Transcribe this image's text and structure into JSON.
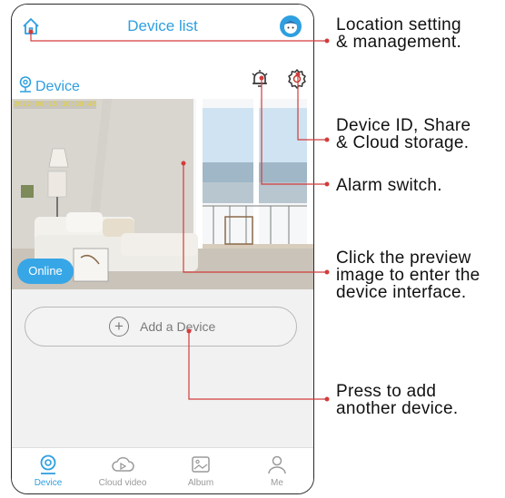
{
  "header": {
    "title": "Device list",
    "home_icon": "home-icon",
    "avatar_icon": "avatar-icon"
  },
  "device": {
    "label": "Device",
    "timestamp": "2022-06-15  10:39:48",
    "status": "Online",
    "alarm_icon": "bell-alarm-icon",
    "settings_icon": "gear-icon"
  },
  "add_device": {
    "label": "Add a Device"
  },
  "tabs": [
    {
      "label": "Device",
      "active": true
    },
    {
      "label": "Cloud video",
      "active": false
    },
    {
      "label": "Album",
      "active": false
    },
    {
      "label": "Me",
      "active": false
    }
  ],
  "callouts": {
    "location": [
      "Location setting",
      "& management."
    ],
    "device_id": [
      "Device ID, Share",
      "& Cloud storage."
    ],
    "alarm": [
      "Alarm switch."
    ],
    "preview": [
      "Click the preview",
      "image to enter the",
      "device interface."
    ],
    "add": [
      "Press to add",
      "another device."
    ]
  },
  "colors": {
    "accent": "#2e9fe0",
    "callout_line": "#d23c3c",
    "timestamp": "#e8d32a"
  }
}
